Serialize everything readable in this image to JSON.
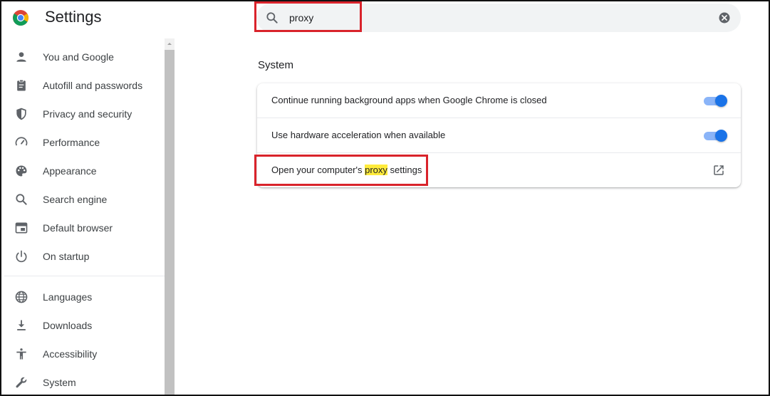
{
  "header": {
    "title": "Settings"
  },
  "search": {
    "value": "proxy"
  },
  "sidebar": {
    "items": [
      {
        "label": "You and Google",
        "icon": "person-icon"
      },
      {
        "label": "Autofill and passwords",
        "icon": "clipboard-icon"
      },
      {
        "label": "Privacy and security",
        "icon": "shield-icon"
      },
      {
        "label": "Performance",
        "icon": "speedometer-icon"
      },
      {
        "label": "Appearance",
        "icon": "palette-icon"
      },
      {
        "label": "Search engine",
        "icon": "search-icon"
      },
      {
        "label": "Default browser",
        "icon": "browser-window-icon"
      },
      {
        "label": "On startup",
        "icon": "power-icon"
      },
      {
        "label": "Languages",
        "icon": "globe-icon"
      },
      {
        "label": "Downloads",
        "icon": "download-icon"
      },
      {
        "label": "Accessibility",
        "icon": "accessibility-icon"
      },
      {
        "label": "System",
        "icon": "wrench-icon"
      }
    ]
  },
  "main": {
    "section_title": "System",
    "rows": [
      {
        "label": "Continue running background apps when Google Chrome is closed",
        "toggle_on": true
      },
      {
        "label": "Use hardware acceleration when available",
        "toggle_on": true
      }
    ],
    "proxy_row": {
      "before": "Open your computer's ",
      "match": "proxy",
      "after": " settings"
    }
  },
  "colors": {
    "accent": "#1a73e8",
    "toggle_track": "#8ab4f8",
    "highlight": "#ffeb3b",
    "annotation": "#d9232b"
  }
}
